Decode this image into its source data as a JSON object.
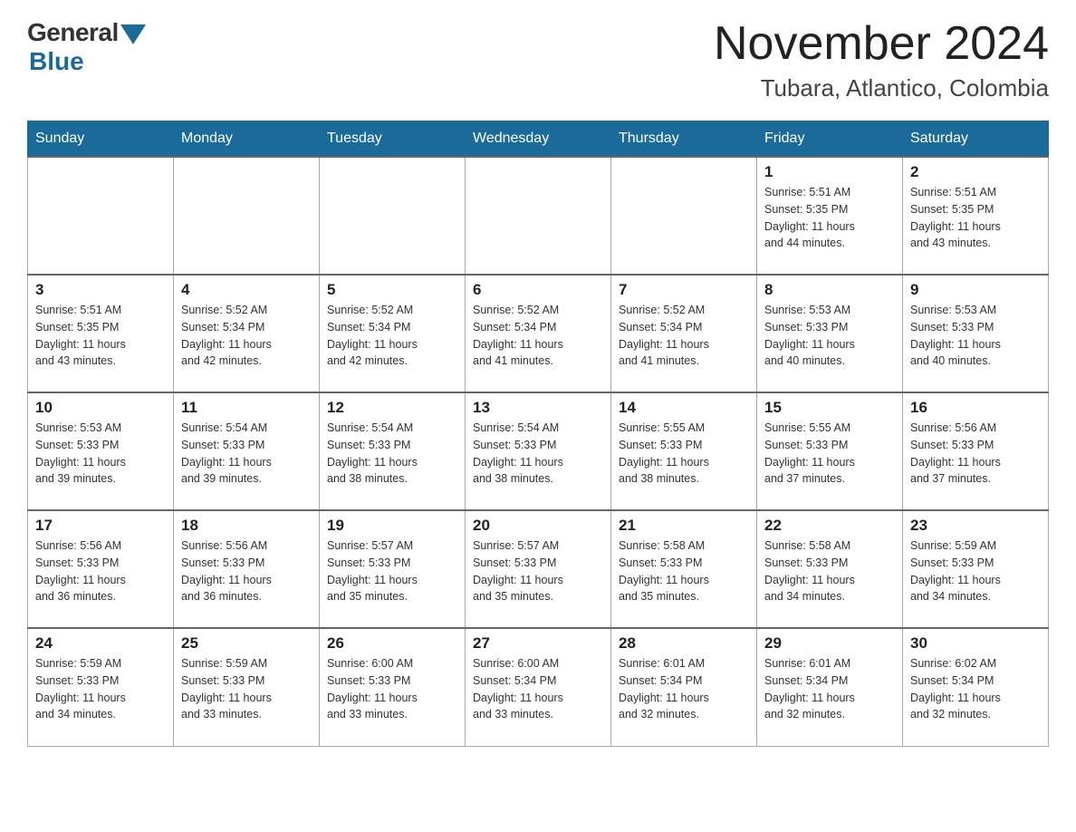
{
  "header": {
    "logo_general": "General",
    "logo_blue": "Blue",
    "month_title": "November 2024",
    "location": "Tubara, Atlantico, Colombia"
  },
  "days_of_week": [
    "Sunday",
    "Monday",
    "Tuesday",
    "Wednesday",
    "Thursday",
    "Friday",
    "Saturday"
  ],
  "weeks": [
    [
      {
        "day": "",
        "info": ""
      },
      {
        "day": "",
        "info": ""
      },
      {
        "day": "",
        "info": ""
      },
      {
        "day": "",
        "info": ""
      },
      {
        "day": "",
        "info": ""
      },
      {
        "day": "1",
        "info": "Sunrise: 5:51 AM\nSunset: 5:35 PM\nDaylight: 11 hours\nand 44 minutes."
      },
      {
        "day": "2",
        "info": "Sunrise: 5:51 AM\nSunset: 5:35 PM\nDaylight: 11 hours\nand 43 minutes."
      }
    ],
    [
      {
        "day": "3",
        "info": "Sunrise: 5:51 AM\nSunset: 5:35 PM\nDaylight: 11 hours\nand 43 minutes."
      },
      {
        "day": "4",
        "info": "Sunrise: 5:52 AM\nSunset: 5:34 PM\nDaylight: 11 hours\nand 42 minutes."
      },
      {
        "day": "5",
        "info": "Sunrise: 5:52 AM\nSunset: 5:34 PM\nDaylight: 11 hours\nand 42 minutes."
      },
      {
        "day": "6",
        "info": "Sunrise: 5:52 AM\nSunset: 5:34 PM\nDaylight: 11 hours\nand 41 minutes."
      },
      {
        "day": "7",
        "info": "Sunrise: 5:52 AM\nSunset: 5:34 PM\nDaylight: 11 hours\nand 41 minutes."
      },
      {
        "day": "8",
        "info": "Sunrise: 5:53 AM\nSunset: 5:33 PM\nDaylight: 11 hours\nand 40 minutes."
      },
      {
        "day": "9",
        "info": "Sunrise: 5:53 AM\nSunset: 5:33 PM\nDaylight: 11 hours\nand 40 minutes."
      }
    ],
    [
      {
        "day": "10",
        "info": "Sunrise: 5:53 AM\nSunset: 5:33 PM\nDaylight: 11 hours\nand 39 minutes."
      },
      {
        "day": "11",
        "info": "Sunrise: 5:54 AM\nSunset: 5:33 PM\nDaylight: 11 hours\nand 39 minutes."
      },
      {
        "day": "12",
        "info": "Sunrise: 5:54 AM\nSunset: 5:33 PM\nDaylight: 11 hours\nand 38 minutes."
      },
      {
        "day": "13",
        "info": "Sunrise: 5:54 AM\nSunset: 5:33 PM\nDaylight: 11 hours\nand 38 minutes."
      },
      {
        "day": "14",
        "info": "Sunrise: 5:55 AM\nSunset: 5:33 PM\nDaylight: 11 hours\nand 38 minutes."
      },
      {
        "day": "15",
        "info": "Sunrise: 5:55 AM\nSunset: 5:33 PM\nDaylight: 11 hours\nand 37 minutes."
      },
      {
        "day": "16",
        "info": "Sunrise: 5:56 AM\nSunset: 5:33 PM\nDaylight: 11 hours\nand 37 minutes."
      }
    ],
    [
      {
        "day": "17",
        "info": "Sunrise: 5:56 AM\nSunset: 5:33 PM\nDaylight: 11 hours\nand 36 minutes."
      },
      {
        "day": "18",
        "info": "Sunrise: 5:56 AM\nSunset: 5:33 PM\nDaylight: 11 hours\nand 36 minutes."
      },
      {
        "day": "19",
        "info": "Sunrise: 5:57 AM\nSunset: 5:33 PM\nDaylight: 11 hours\nand 35 minutes."
      },
      {
        "day": "20",
        "info": "Sunrise: 5:57 AM\nSunset: 5:33 PM\nDaylight: 11 hours\nand 35 minutes."
      },
      {
        "day": "21",
        "info": "Sunrise: 5:58 AM\nSunset: 5:33 PM\nDaylight: 11 hours\nand 35 minutes."
      },
      {
        "day": "22",
        "info": "Sunrise: 5:58 AM\nSunset: 5:33 PM\nDaylight: 11 hours\nand 34 minutes."
      },
      {
        "day": "23",
        "info": "Sunrise: 5:59 AM\nSunset: 5:33 PM\nDaylight: 11 hours\nand 34 minutes."
      }
    ],
    [
      {
        "day": "24",
        "info": "Sunrise: 5:59 AM\nSunset: 5:33 PM\nDaylight: 11 hours\nand 34 minutes."
      },
      {
        "day": "25",
        "info": "Sunrise: 5:59 AM\nSunset: 5:33 PM\nDaylight: 11 hours\nand 33 minutes."
      },
      {
        "day": "26",
        "info": "Sunrise: 6:00 AM\nSunset: 5:33 PM\nDaylight: 11 hours\nand 33 minutes."
      },
      {
        "day": "27",
        "info": "Sunrise: 6:00 AM\nSunset: 5:34 PM\nDaylight: 11 hours\nand 33 minutes."
      },
      {
        "day": "28",
        "info": "Sunrise: 6:01 AM\nSunset: 5:34 PM\nDaylight: 11 hours\nand 32 minutes."
      },
      {
        "day": "29",
        "info": "Sunrise: 6:01 AM\nSunset: 5:34 PM\nDaylight: 11 hours\nand 32 minutes."
      },
      {
        "day": "30",
        "info": "Sunrise: 6:02 AM\nSunset: 5:34 PM\nDaylight: 11 hours\nand 32 minutes."
      }
    ]
  ]
}
